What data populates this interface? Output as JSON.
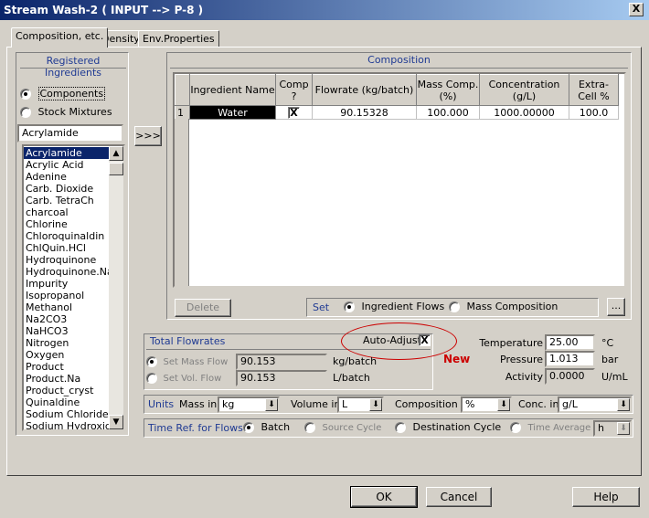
{
  "window": {
    "title": "Stream Wash-2 ( INPUT --> P-8 )",
    "close": "X"
  },
  "tabs": [
    {
      "label": "Composition, etc."
    },
    {
      "label": "Density"
    },
    {
      "label": "Env.Properties"
    }
  ],
  "ingredients": {
    "header": "Registered Ingredients",
    "radio_components": "Components",
    "radio_stock": "Stock Mixtures",
    "search_value": "Acrylamide",
    "transfer_label": ">>>",
    "items": [
      "Acrylamide",
      "Acrylic Acid",
      "Adenine",
      "Carb. Dioxide",
      "Carb. TetraCh",
      "charcoal",
      "Chlorine",
      "Chloroquinaldin",
      "ChlQuin.HCl",
      "Hydroquinone",
      "Hydroquinone.Na",
      "Impurity",
      "Isopropanol",
      "Methanol",
      "Na2CO3",
      "NaHCO3",
      "Nitrogen",
      "Oxygen",
      "Product",
      "Product.Na",
      "Product_cryst",
      "Quinaldine",
      "Sodium Chloride",
      "Sodium Hydroxid"
    ]
  },
  "composition": {
    "header": "Composition",
    "columns": [
      "Ingredient Name",
      "Comp ?",
      "Flowrate (kg/batch)",
      "Mass Comp. (%)",
      "Concentration (g/L)",
      "Extra-Cell %"
    ],
    "rows": [
      {
        "num": "1",
        "name": "Water",
        "comp": "X",
        "flow": "90.15328",
        "mass": "100.000",
        "conc": "1000.00000",
        "extra": "100.0"
      }
    ],
    "delete_label": "Delete",
    "set_label": "Set",
    "set_ingredient": "Ingredient Flows",
    "set_mass": "Mass Composition",
    "more_label": "..."
  },
  "totals": {
    "header": "Total Flowrates",
    "auto_adjust": "Auto-Adjust",
    "auto_adjust_checked": "X",
    "new_label": "New",
    "mass_label": "Set Mass Flow",
    "mass_value": "90.153",
    "mass_unit": "kg/batch",
    "vol_label": "Set Vol. Flow",
    "vol_value": "90.153",
    "vol_unit": "L/batch"
  },
  "props": {
    "temp_label": "Temperature",
    "temp_value": "25.00",
    "temp_unit": "°C",
    "press_label": "Pressure",
    "press_value": "1.013",
    "press_unit": "bar",
    "act_label": "Activity",
    "act_value": "0.0000",
    "act_unit": "U/mL"
  },
  "units": {
    "header": "Units",
    "mass_label": "Mass in",
    "mass_value": "kg",
    "vol_label": "Volume in",
    "vol_value": "L",
    "comp_label": "Composition in",
    "comp_value": "%",
    "conc_label": "Conc. in",
    "conc_value": "g/L"
  },
  "timeref": {
    "header": "Time Ref. for Flows",
    "batch": "Batch",
    "source": "Source Cycle",
    "dest": "Destination Cycle",
    "avg": "Time Average",
    "avg_unit": "h"
  },
  "buttons": {
    "ok": "OK",
    "cancel": "Cancel",
    "help": "Help"
  },
  "colors": {
    "title_bar": "#0a246a",
    "selection": "#0a246a",
    "new_label": "#cc0000",
    "annotation_circle": "#cc0000",
    "group_header": "#1f3a93"
  }
}
